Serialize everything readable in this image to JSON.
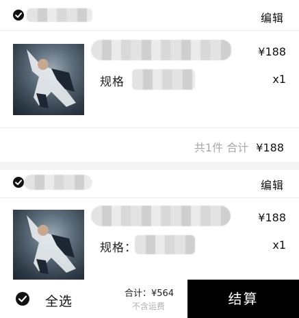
{
  "stores": [
    {
      "edit_label": "编辑",
      "item": {
        "price": "¥188",
        "spec_label": "规格",
        "quantity": "x1"
      },
      "summary": {
        "count_text": "共1件",
        "total_label": "合计",
        "total": "¥188"
      }
    },
    {
      "edit_label": "编辑",
      "item": {
        "price": "¥188",
        "spec_label": "规格：",
        "quantity": "x1"
      }
    }
  ],
  "footer": {
    "select_all": "全选",
    "total_line": "合计：¥564",
    "shipping_note": "不含运费",
    "checkout": "结算"
  },
  "colors": {
    "checkout_bg": "#000000",
    "muted_text": "#a8a8a8"
  }
}
